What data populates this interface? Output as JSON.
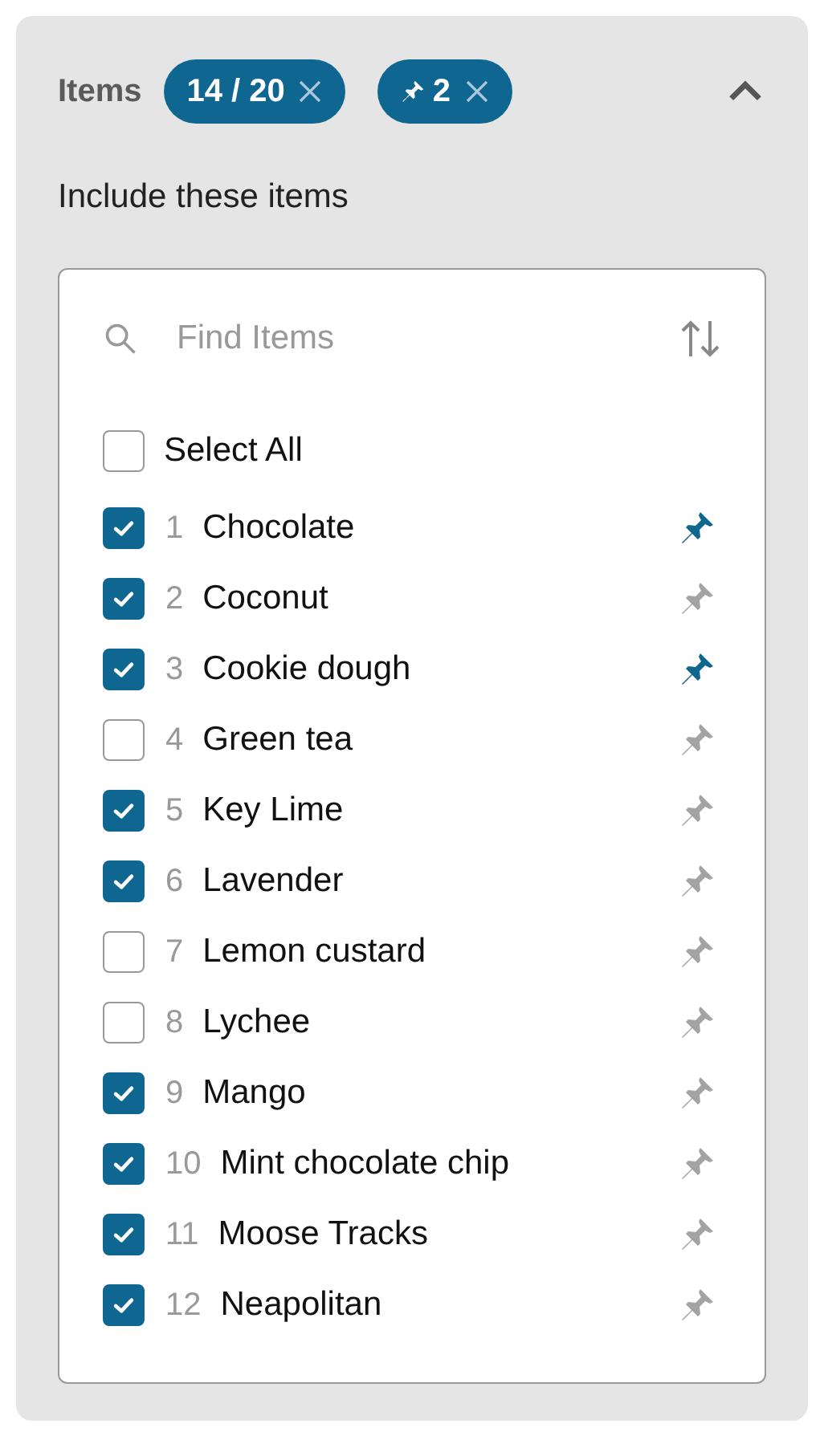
{
  "header": {
    "title": "Items",
    "chips": [
      {
        "kind": "count",
        "label": "14 / 20"
      },
      {
        "kind": "pinned",
        "label": "2"
      }
    ],
    "expanded": true
  },
  "section_label": "Include these items",
  "search": {
    "placeholder": "Find Items"
  },
  "select_all": {
    "label": "Select All",
    "checked": false
  },
  "items": [
    {
      "number": "1",
      "name": "Chocolate",
      "checked": true,
      "pinned": true
    },
    {
      "number": "2",
      "name": "Coconut",
      "checked": true,
      "pinned": false
    },
    {
      "number": "3",
      "name": "Cookie dough",
      "checked": true,
      "pinned": true
    },
    {
      "number": "4",
      "name": "Green tea",
      "checked": false,
      "pinned": false
    },
    {
      "number": "5",
      "name": "Key Lime",
      "checked": true,
      "pinned": false
    },
    {
      "number": "6",
      "name": "Lavender",
      "checked": true,
      "pinned": false
    },
    {
      "number": "7",
      "name": "Lemon custard",
      "checked": false,
      "pinned": false
    },
    {
      "number": "8",
      "name": "Lychee",
      "checked": false,
      "pinned": false
    },
    {
      "number": "9",
      "name": "Mango",
      "checked": true,
      "pinned": false
    },
    {
      "number": "10",
      "name": "Mint chocolate chip",
      "checked": true,
      "pinned": false
    },
    {
      "number": "11",
      "name": "Moose Tracks",
      "checked": true,
      "pinned": false
    },
    {
      "number": "12",
      "name": "Neapolitan",
      "checked": true,
      "pinned": false
    }
  ]
}
